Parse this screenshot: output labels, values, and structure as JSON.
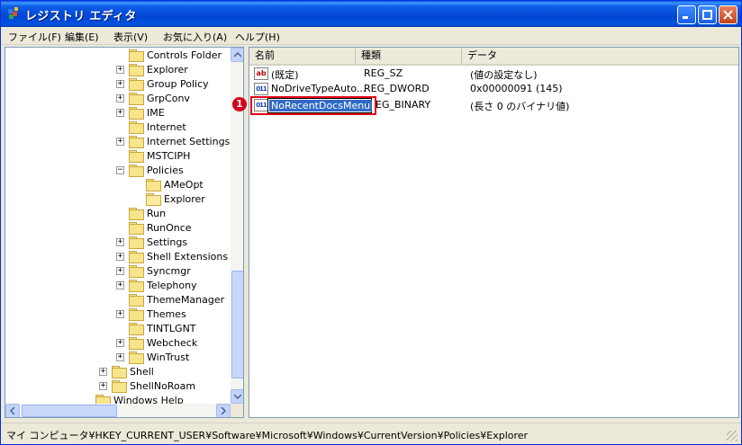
{
  "window": {
    "title": "レジストリ エディタ"
  },
  "menu": {
    "items": [
      "ファイル(F)",
      "編集(E)",
      "表示(V)",
      "お気に入り(A)",
      "ヘルプ(H)"
    ]
  },
  "tree": {
    "items": [
      {
        "label": "Controls Folder",
        "expander": ""
      },
      {
        "label": "Explorer",
        "expander": "+"
      },
      {
        "label": "Group Policy",
        "expander": "+"
      },
      {
        "label": "GrpConv",
        "expander": "+"
      },
      {
        "label": "IME",
        "expander": "+"
      },
      {
        "label": "Internet",
        "expander": ""
      },
      {
        "label": "Internet Settings",
        "expander": "+"
      },
      {
        "label": "MSTCIPH",
        "expander": ""
      },
      {
        "label": "Policies",
        "expander": "−"
      },
      {
        "label": "AMeOpt",
        "expander": ""
      },
      {
        "label": "Explorer",
        "expander": ""
      },
      {
        "label": "Run",
        "expander": ""
      },
      {
        "label": "RunOnce",
        "expander": ""
      },
      {
        "label": "Settings",
        "expander": "+"
      },
      {
        "label": "Shell Extensions",
        "expander": "+"
      },
      {
        "label": "Syncmgr",
        "expander": "+"
      },
      {
        "label": "Telephony",
        "expander": "+"
      },
      {
        "label": "ThemeManager",
        "expander": ""
      },
      {
        "label": "Themes",
        "expander": "+"
      },
      {
        "label": "TINTLGNT",
        "expander": ""
      },
      {
        "label": "Webcheck",
        "expander": "+"
      },
      {
        "label": "WinTrust",
        "expander": "+"
      },
      {
        "label": "Shell",
        "expander": "+"
      },
      {
        "label": "ShellNoRoam",
        "expander": "+"
      },
      {
        "label": "Windows Help",
        "expander": ""
      }
    ]
  },
  "list": {
    "columns": [
      "名前",
      "種類",
      "データ"
    ],
    "rows": [
      {
        "name": "(既定)",
        "type": "REG_SZ",
        "data": "(値の設定なし)",
        "icon": "ab"
      },
      {
        "name": "NoDriveTypeAuto...",
        "type": "REG_DWORD",
        "data": "0x00000091 (145)",
        "icon": "011"
      },
      {
        "name": "NoRecentDocsMenu",
        "type": "EG_BINARY",
        "data": "(長さ 0 のバイナリ値)",
        "icon": "011"
      }
    ],
    "callout_number": "1"
  },
  "status": {
    "path": "マイ コンピュータ¥HKEY_CURRENT_USER¥Software¥Microsoft¥Windows¥CurrentVersion¥Policies¥Explorer"
  },
  "colors": {
    "titlebar": "#0054e3",
    "selection": "#316ac5",
    "callout": "#e0001a",
    "folder": "#f8e48a"
  }
}
